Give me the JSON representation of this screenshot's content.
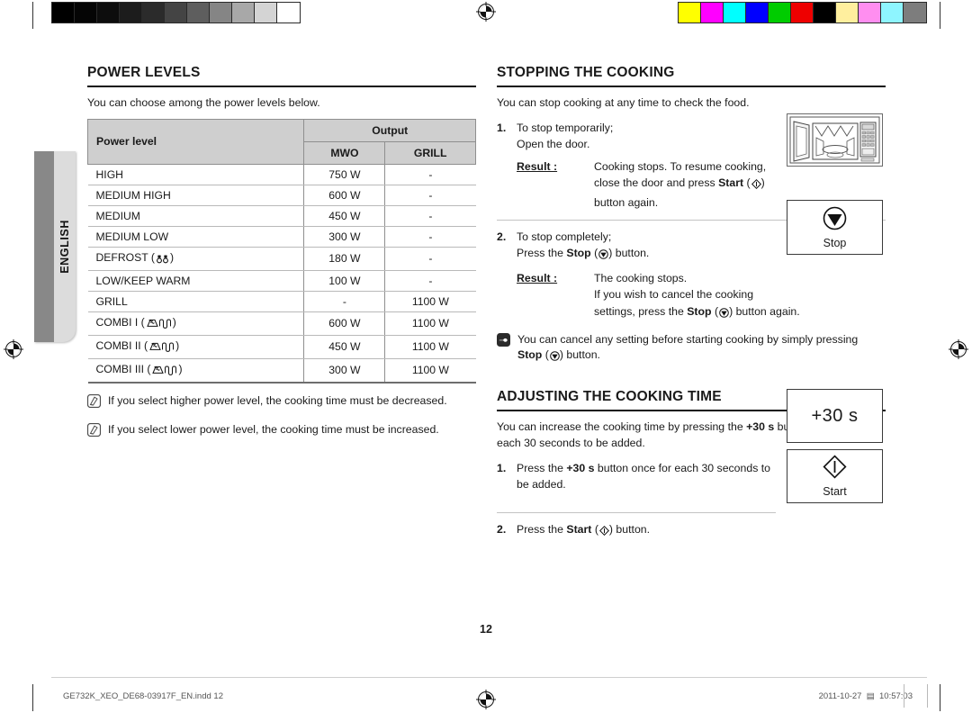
{
  "document": {
    "language_tab": "ENGLISH",
    "page_number": "12",
    "footer_file": "GE732K_XEO_DE68-03917F_EN.indd   12",
    "footer_date": "2011-10-27",
    "footer_time": "10:57:03"
  },
  "calibration": {
    "gray_swatches": [
      "#000000",
      "#050505",
      "#0d0d0d",
      "#1c1c1c",
      "#2b2b2b",
      "#444444",
      "#5e5e5e",
      "#858585",
      "#a8a8a8",
      "#d4d4d4",
      "#ffffff"
    ],
    "color_swatches": [
      "#ffff00",
      "#ff00ff",
      "#00ffff",
      "#0000ff",
      "#00cc00",
      "#ee0000",
      "#000000",
      "#ffef9e",
      "#ff8ef0",
      "#8ef5ff",
      "#7d7d7d"
    ]
  },
  "power_levels": {
    "title": "POWER LEVELS",
    "lead": "You can choose among the power levels below.",
    "table": {
      "header_level": "Power level",
      "header_output": "Output",
      "header_mwo": "MWO",
      "header_grill": "GRILL",
      "rows": [
        {
          "level": "HIGH",
          "icon": "",
          "mwo": "750 W",
          "grill": "-"
        },
        {
          "level": "MEDIUM HIGH",
          "icon": "",
          "mwo": "600 W",
          "grill": "-"
        },
        {
          "level": "MEDIUM",
          "icon": "",
          "mwo": "450 W",
          "grill": "-"
        },
        {
          "level": "MEDIUM LOW",
          "icon": "",
          "mwo": "300 W",
          "grill": "-"
        },
        {
          "level": "DEFROST",
          "icon": "defrost-icon",
          "mwo": "180 W",
          "grill": "-"
        },
        {
          "level": "LOW/KEEP WARM",
          "icon": "",
          "mwo": "100 W",
          "grill": "-"
        },
        {
          "level": "GRILL",
          "icon": "",
          "mwo": "-",
          "grill": "1100 W"
        },
        {
          "level": "COMBI I",
          "icon": "combi-icon",
          "mwo": "600 W",
          "grill": "1100 W"
        },
        {
          "level": "COMBI II",
          "icon": "combi-icon",
          "mwo": "450 W",
          "grill": "1100 W"
        },
        {
          "level": "COMBI III",
          "icon": "combi-icon",
          "mwo": "300 W",
          "grill": "1100 W"
        }
      ]
    },
    "notes": [
      "If you select higher power level, the cooking time must be decreased.",
      "If you select lower power level, the cooking time must be increased."
    ]
  },
  "stopping": {
    "title": "STOPPING THE COOKING",
    "lead": "You can stop cooking at any time to check the food.",
    "step1": {
      "num": "1.",
      "line1": "To stop temporarily;",
      "line2": "Open the door.",
      "result_label": "Result :",
      "result_line1": "Cooking stops. To resume cooking,",
      "result_line2_pre": "close the door and press ",
      "result_line2_kw": "Start",
      "result_line2_post": ")",
      "result_line3": "button again."
    },
    "step2": {
      "num": "2.",
      "line1": "To stop completely;",
      "line2_pre": "Press the ",
      "line2_kw": "Stop",
      "line2_post": ") button.",
      "result_label": "Result :",
      "result_line1": "The cooking stops.",
      "result_line2": "If you wish to cancel the cooking",
      "result_line3_pre": "settings, press the ",
      "result_line3_kw": "Stop",
      "result_line3_post": ") button again."
    },
    "tip": {
      "line1": "You can cancel any setting before starting cooking by simply pressing",
      "kw": "Stop",
      "line2_post": ") button."
    },
    "figure_oven_alt": "microwave-oven-open-door",
    "figure_stop_caption": "Stop"
  },
  "adjusting": {
    "title": "ADJUSTING THE COOKING TIME",
    "lead_pre": "You can increase the cooking time by pressing the ",
    "lead_kw": "+30 s",
    "lead_post": " button once for",
    "lead_line2": "each 30 seconds to be added.",
    "step1": {
      "num": "1.",
      "pre": "Press the ",
      "kw": "+30 s",
      "post": " button once for each 30 seconds to",
      "line2": "be added."
    },
    "step2": {
      "num": "2.",
      "pre": "Press the ",
      "kw": "Start",
      "post": ") button."
    },
    "figure_30s_label": "+30 s",
    "figure_start_caption": "Start"
  }
}
